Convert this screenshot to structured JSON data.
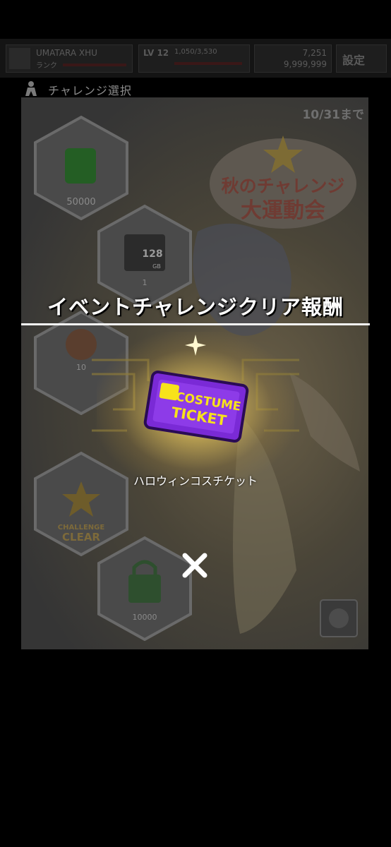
{
  "topbar": {
    "player_name": "UMATARA XHU",
    "player_sub": "ランク",
    "stage_label": "LV 12",
    "stage_value": "1,050/3,530",
    "currency_value": "7,251",
    "currency_sub": "9,999,999",
    "menu_label": "設定"
  },
  "header": {
    "title": "チャレンジ選択",
    "icon": "character-icon"
  },
  "event": {
    "deadline": "10/31まで",
    "logo_line1": "秋のチャレンジ",
    "logo_line2": "大運動会"
  },
  "challenges": [
    {
      "icon": "barrel-icon",
      "value": "50000"
    },
    {
      "icon": "memory-card-icon",
      "value": "1",
      "card_label": "128",
      "card_unit": "GB"
    },
    {
      "icon": "costume-badge-icon",
      "value": "10"
    },
    {
      "icon": "challenge-clear-badge-icon",
      "badge_line1": "CHALLENGE",
      "badge_line2": "CLEAR"
    },
    {
      "icon": "lock-icon",
      "value": "10000"
    }
  ],
  "reward": {
    "title": "イベントチャレンジクリア報酬",
    "ticket_line1": "COSTUME",
    "ticket_line2": "TICKET",
    "item_name": "ハロウィンコスチケット",
    "close_icon": "close-icon"
  },
  "colors": {
    "ticket_purple": "#7a2ad6",
    "ticket_text": "#f7e21b",
    "glow_gold": "#f0d060"
  }
}
